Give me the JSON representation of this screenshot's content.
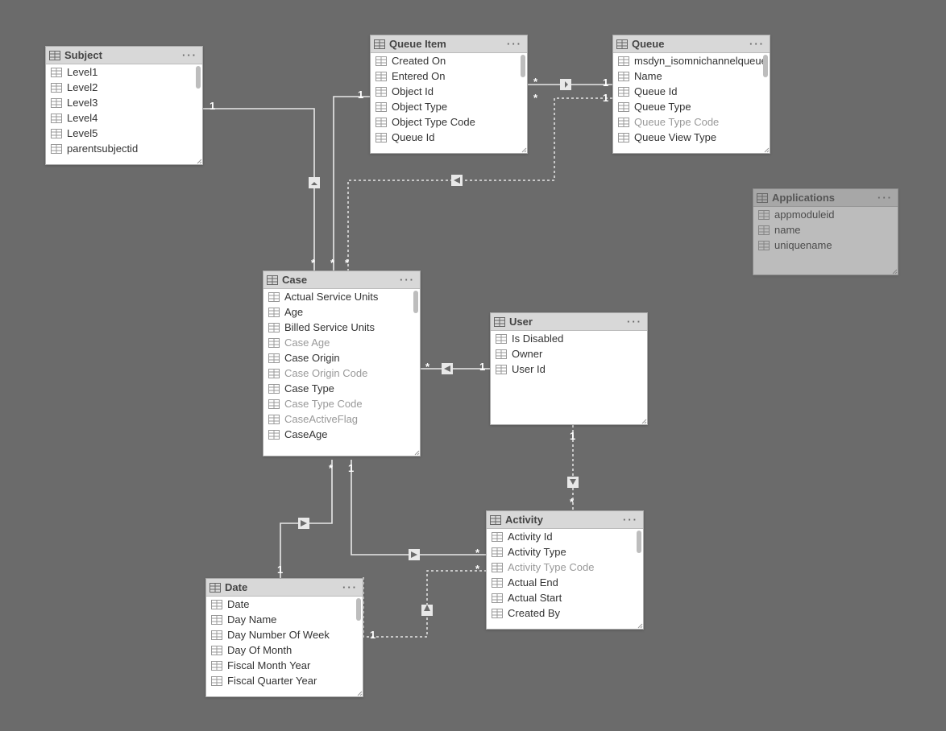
{
  "tables": {
    "subject": {
      "title": "Subject",
      "fields": [
        {
          "label": "Level1"
        },
        {
          "label": "Level2"
        },
        {
          "label": "Level3"
        },
        {
          "label": "Level4"
        },
        {
          "label": "Level5"
        },
        {
          "label": "parentsubjectid"
        }
      ]
    },
    "queueItem": {
      "title": "Queue Item",
      "fields": [
        {
          "label": "Created On"
        },
        {
          "label": "Entered On"
        },
        {
          "label": "Object Id"
        },
        {
          "label": "Object Type"
        },
        {
          "label": "Object Type Code"
        },
        {
          "label": "Queue Id"
        }
      ]
    },
    "queue": {
      "title": "Queue",
      "fields": [
        {
          "label": "msdyn_isomnichannelqueue"
        },
        {
          "label": "Name"
        },
        {
          "label": "Queue Id"
        },
        {
          "label": "Queue Type"
        },
        {
          "label": "Queue Type Code",
          "dim": true
        },
        {
          "label": "Queue View Type"
        }
      ]
    },
    "applications": {
      "title": "Applications",
      "fields": [
        {
          "label": "appmoduleid"
        },
        {
          "label": "name"
        },
        {
          "label": "uniquename"
        }
      ]
    },
    "case": {
      "title": "Case",
      "fields": [
        {
          "label": "Actual Service Units"
        },
        {
          "label": "Age"
        },
        {
          "label": "Billed Service Units"
        },
        {
          "label": "Case Age",
          "dim": true
        },
        {
          "label": "Case Origin"
        },
        {
          "label": "Case Origin Code",
          "dim": true
        },
        {
          "label": "Case Type"
        },
        {
          "label": "Case Type Code",
          "dim": true
        },
        {
          "label": "CaseActiveFlag",
          "dim": true
        },
        {
          "label": "CaseAge"
        }
      ]
    },
    "user": {
      "title": "User",
      "fields": [
        {
          "label": "Is Disabled"
        },
        {
          "label": "Owner"
        },
        {
          "label": "User Id"
        }
      ]
    },
    "activity": {
      "title": "Activity",
      "fields": [
        {
          "label": "Activity Id"
        },
        {
          "label": "Activity Type"
        },
        {
          "label": "Activity Type Code",
          "dim": true
        },
        {
          "label": "Actual End"
        },
        {
          "label": "Actual Start"
        },
        {
          "label": "Created By"
        }
      ]
    },
    "date": {
      "title": "Date",
      "fields": [
        {
          "label": "Date"
        },
        {
          "label": "Day Name"
        },
        {
          "label": "Day Number Of Week"
        },
        {
          "label": "Day Of Month"
        },
        {
          "label": "Fiscal Month Year"
        },
        {
          "label": "Fiscal Quarter Year"
        }
      ]
    }
  },
  "dots": "···",
  "cardinality": {
    "one": "1",
    "many": "*"
  }
}
